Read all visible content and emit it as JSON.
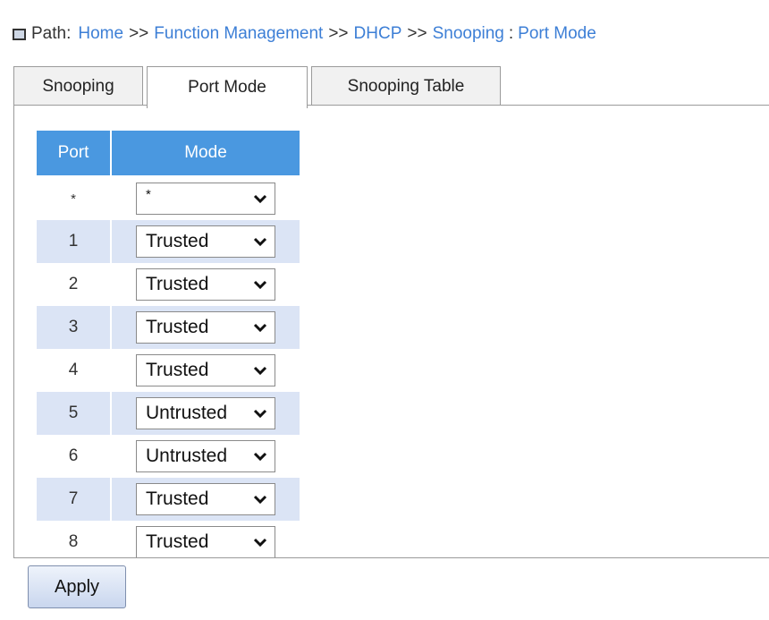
{
  "path": {
    "label": "Path:",
    "crumbs": [
      "Home",
      "Function Management",
      "DHCP",
      "Snooping"
    ],
    "separator": ">>",
    "current_sep": ":",
    "current": "Port Mode"
  },
  "tabs": [
    {
      "label": "Snooping",
      "active": false
    },
    {
      "label": "Port Mode",
      "active": true
    },
    {
      "label": "Snooping Table",
      "active": false
    }
  ],
  "table": {
    "headers": {
      "port": "Port",
      "mode": "Mode"
    },
    "rows": [
      {
        "port": "*",
        "mode": "*"
      },
      {
        "port": "1",
        "mode": "Trusted"
      },
      {
        "port": "2",
        "mode": "Trusted"
      },
      {
        "port": "3",
        "mode": "Trusted"
      },
      {
        "port": "4",
        "mode": "Trusted"
      },
      {
        "port": "5",
        "mode": "Untrusted"
      },
      {
        "port": "6",
        "mode": "Untrusted"
      },
      {
        "port": "7",
        "mode": "Trusted"
      },
      {
        "port": "8",
        "mode": "Trusted"
      }
    ]
  },
  "apply_label": "Apply",
  "colors": {
    "header_bg": "#4a98e0",
    "stripe": "#dbe4f5",
    "link": "#3d7fd6"
  },
  "icons": {
    "path_icon": "window-icon",
    "select_arrow": "chevron-down-icon"
  }
}
